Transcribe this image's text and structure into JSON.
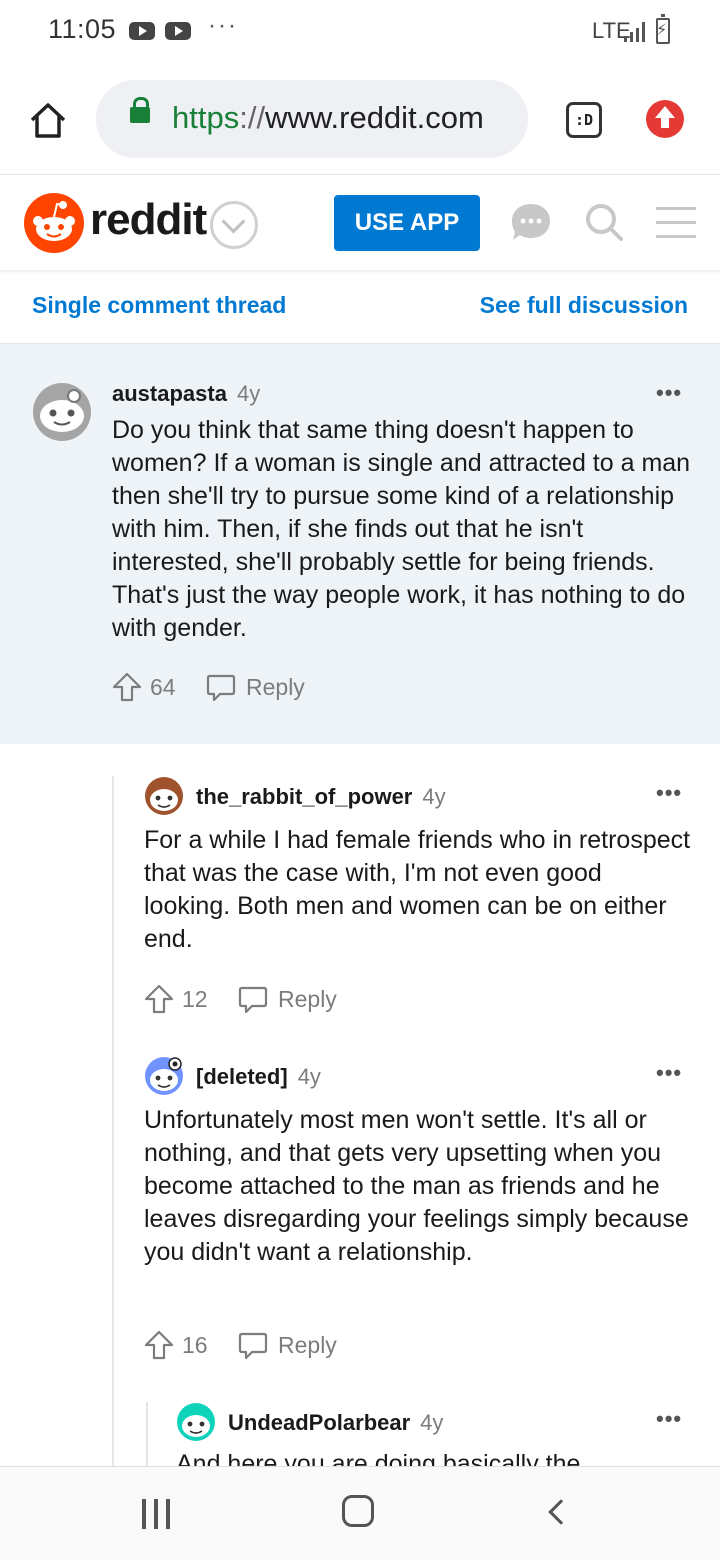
{
  "status_bar": {
    "time": "11:05",
    "dots": "···",
    "network": "LTE"
  },
  "browser": {
    "url_scheme": "https",
    "url_separator": "://",
    "url_host": "www.reddit.com",
    "tabs_label": ":D"
  },
  "reddit_header": {
    "wordmark": "reddit",
    "use_app_label": "USE APP",
    "brand_color": "#ff4500",
    "accent_color": "#0079d3"
  },
  "thread_nav": {
    "single_label": "Single comment thread",
    "full_label": "See full discussion"
  },
  "comments": [
    {
      "author": "austapasta",
      "age": "4y",
      "body": "Do you think that same thing doesn't happen to women? If a woman is single and attracted to a man then she'll try to pursue some kind of a relationship with him. Then, if she finds out that he isn't interested, she'll probably settle for being friends. That's just the way people work, it has nothing to do with gender.",
      "score": "64",
      "reply_label": "Reply"
    },
    {
      "author": "the_rabbit_of_power",
      "age": "4y",
      "body": "For a while I had female friends who in retrospect that was the case with, I'm not even good looking. Both men and women can be on either end.",
      "score": "12",
      "reply_label": "Reply"
    },
    {
      "author": "[deleted]",
      "age": "4y",
      "body": "Unfortunately most men won't settle. It's all or nothing, and that gets very upsetting when you become attached to the man as friends and he leaves disregarding your feelings simply because you didn't want a relationship.",
      "score": "16",
      "reply_label": "Reply"
    },
    {
      "author": "UndeadPolarbear",
      "age": "4y",
      "body": "And here you are doing basically the",
      "score": "",
      "reply_label": ""
    }
  ],
  "more_label": "•••"
}
